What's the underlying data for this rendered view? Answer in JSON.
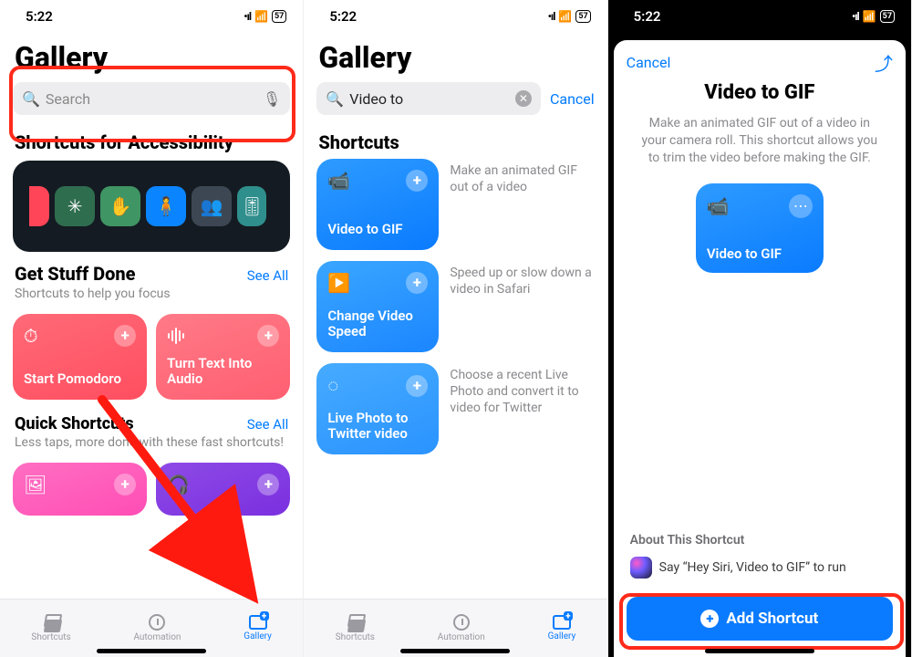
{
  "status": {
    "time": "5:22",
    "battery": "57"
  },
  "screen1": {
    "title": "Gallery",
    "search_placeholder": "Search",
    "section_accessibility": "Shortcuts for Accessibility",
    "getstuff": {
      "title": "Get Stuff Done",
      "sub": "Shortcuts to help you focus",
      "seeall": "See All"
    },
    "card_pomodoro": "Start Pomodoro",
    "card_textaudio": "Turn Text Into Audio",
    "quick": {
      "title": "Quick Shortcuts",
      "sub": "Less taps, more done with these fast shortcuts!",
      "seeall": "See All"
    }
  },
  "screen2": {
    "title": "Gallery",
    "search_value": "Video to",
    "cancel": "Cancel",
    "section": "Shortcuts",
    "results": [
      {
        "label": "Video to GIF",
        "desc": "Make an animated GIF out of a video"
      },
      {
        "label": "Change Video Speed",
        "desc": "Speed up or slow down a video in Safari"
      },
      {
        "label": "Live Photo to Twitter video",
        "desc": "Choose a recent Live Photo and convert it to video for Twitter"
      }
    ]
  },
  "screen3": {
    "cancel": "Cancel",
    "title": "Video to GIF",
    "desc": "Make an animated GIF out of a video in your camera roll. This shortcut allows you to trim the video before making the GIF.",
    "card_label": "Video to GIF",
    "about_title": "About This Shortcut",
    "siri_text": "Say “Hey Siri, Video to GIF” to run",
    "add_button": "Add Shortcut"
  },
  "tabs": {
    "shortcuts": "Shortcuts",
    "automation": "Automation",
    "gallery": "Gallery"
  }
}
